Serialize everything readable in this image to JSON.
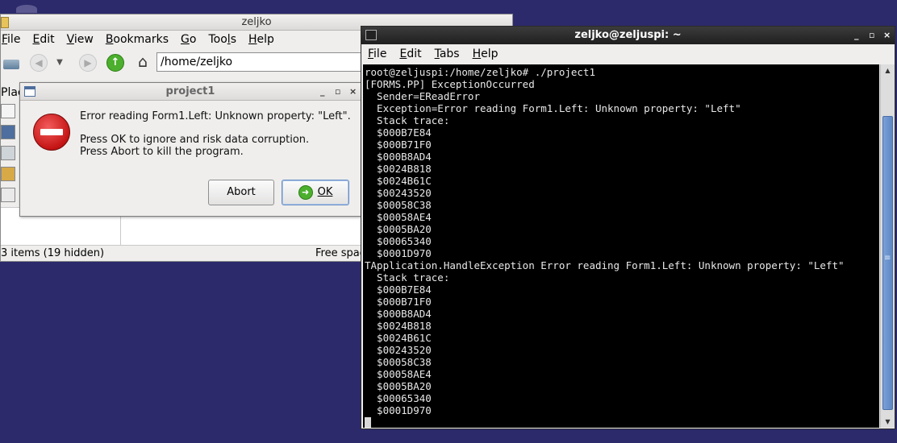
{
  "file_manager": {
    "title": "zeljko",
    "menu": [
      {
        "label": "File",
        "key": "F"
      },
      {
        "label": "Edit",
        "key": "E"
      },
      {
        "label": "View",
        "key": "V"
      },
      {
        "label": "Bookmarks",
        "key": "B"
      },
      {
        "label": "Go",
        "key": "G"
      },
      {
        "label": "Tools",
        "key": "l"
      },
      {
        "label": "Help",
        "key": "H"
      }
    ],
    "path": "/home/zeljko",
    "places_label": "Plac",
    "status_left": "3 items (19 hidden)",
    "status_right": "Free spac"
  },
  "dialog": {
    "title": "project1",
    "message_line1": "Error reading Form1.Left: Unknown property: \"Left\".",
    "message_line2": "Press OK to ignore and risk data corruption.",
    "message_line3": "Press Abort to kill the program.",
    "abort_label": "Abort",
    "ok_label": "OK"
  },
  "terminal": {
    "title": "zeljko@zeljuspi: ~",
    "menu": [
      "File",
      "Edit",
      "Tabs",
      "Help"
    ],
    "lines": [
      "root@zeljuspi:/home/zeljko# ./project1",
      "[FORMS.PP] ExceptionOccurred",
      "  Sender=EReadError",
      "  Exception=Error reading Form1.Left: Unknown property: \"Left\"",
      "  Stack trace:",
      "  $000B7E84",
      "  $000B71F0",
      "  $000B8AD4",
      "  $0024B818",
      "  $0024B61C",
      "  $00243520",
      "  $00058C38",
      "  $00058AE4",
      "  $0005BA20",
      "  $00065340",
      "  $0001D970",
      "TApplication.HandleException Error reading Form1.Left: Unknown property: \"Left\"",
      "  Stack trace:",
      "  $000B7E84",
      "  $000B71F0",
      "  $000B8AD4",
      "  $0024B818",
      "  $0024B61C",
      "  $00243520",
      "  $00058C38",
      "  $00058AE4",
      "  $0005BA20",
      "  $00065340",
      "  $0001D970"
    ]
  },
  "window_controls": {
    "minimize": "_",
    "maximize": "▫",
    "close": "×"
  },
  "icons": [
    "stop-icon",
    "ok-icon",
    "home-icon",
    "back-icon",
    "forward-icon",
    "up-icon",
    "terminal-icon",
    "folder-icon"
  ]
}
